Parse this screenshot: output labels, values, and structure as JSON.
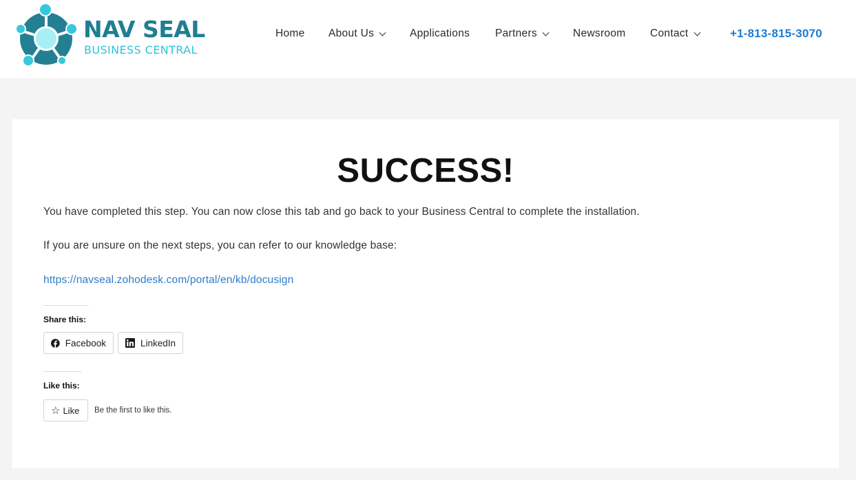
{
  "header": {
    "logo": {
      "title": "NAV SEAL",
      "subtitle": "BUSINESS CENTRAL"
    },
    "nav": [
      {
        "label": "Home"
      },
      {
        "label": "About Us"
      },
      {
        "label": "Applications"
      },
      {
        "label": "Partners"
      },
      {
        "label": "Newsroom"
      },
      {
        "label": "Contact"
      }
    ],
    "phone": "+1-813-815-3070"
  },
  "content": {
    "title": "SUCCESS!",
    "paragraph_1": "You have completed this step. You can now close this tab and go back to your Business Central to complete the installation.",
    "paragraph_2": "If you are unsure on the next steps, you can refer to our knowledge base:",
    "kb_link": "https://navseal.zohodesk.com/portal/en/kb/docusign"
  },
  "share": {
    "label": "Share this:",
    "facebook": "Facebook",
    "linkedin": "LinkedIn"
  },
  "like": {
    "label": "Like this:",
    "button": "Like",
    "note": "Be the first to like this."
  },
  "colors": {
    "brand_teal": "#1f7f92",
    "brand_cyan": "#2fc4d8",
    "phone_blue": "#1c7cd2",
    "link_blue": "#2f7dc9",
    "page_bg": "#f4f4f4"
  },
  "icons": [
    "logo-mark-icon",
    "chevron-down-icon",
    "facebook-icon",
    "linkedin-icon",
    "star-icon"
  ]
}
